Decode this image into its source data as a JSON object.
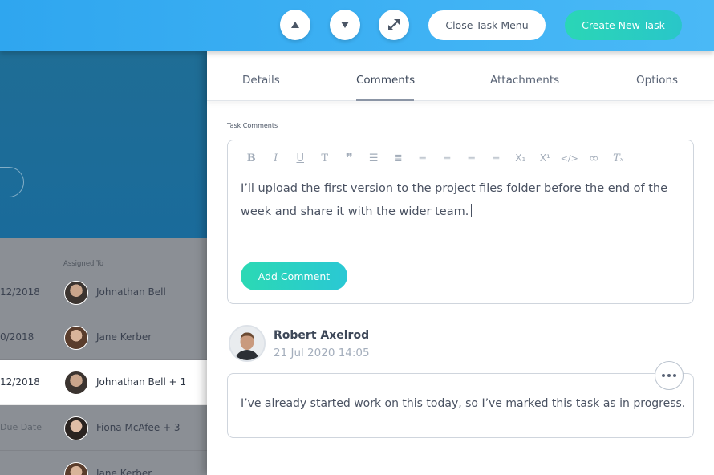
{
  "topbar": {
    "buttons": {
      "move_up": {
        "icon": "caret-up-icon"
      },
      "move_down": {
        "icon": "caret-down-icon"
      },
      "expand": {
        "icon": "expand-arrows-icon"
      },
      "close_label": "Close Task Menu",
      "create_label": "Create New Task"
    },
    "colors": {
      "bar": "#3aaef2",
      "create": "#2ad3b9"
    }
  },
  "task_list": {
    "assigned_header": "Assigned To",
    "rows": [
      {
        "date": "12/2018",
        "assignee": "Johnathan Bell",
        "selected": false
      },
      {
        "date": "0/2018",
        "assignee": "Jane Kerber",
        "selected": false
      },
      {
        "date": "12/2018",
        "assignee": "Johnathan Bell + 1",
        "selected": true
      },
      {
        "date": "Due Date",
        "assignee": "Fiona McAfee + 3",
        "selected": false
      },
      {
        "date": "",
        "assignee": "Jane Kerber",
        "selected": false
      }
    ]
  },
  "panel": {
    "tabs": [
      {
        "label": "Details",
        "active": false
      },
      {
        "label": "Comments",
        "active": true
      },
      {
        "label": "Attachments",
        "active": false
      },
      {
        "label": "Options",
        "active": false
      }
    ],
    "section_label": "Task Comments",
    "editor": {
      "toolbar": [
        {
          "name": "bold-icon",
          "glyph": "B"
        },
        {
          "name": "italic-icon",
          "glyph": "I"
        },
        {
          "name": "underline-icon",
          "glyph": "U"
        },
        {
          "name": "strikethrough-icon",
          "glyph": "T"
        },
        {
          "name": "blockquote-icon",
          "glyph": "❞"
        },
        {
          "name": "bullet-list-icon",
          "glyph": "☰"
        },
        {
          "name": "numbered-list-icon",
          "glyph": "≣"
        },
        {
          "name": "justify-icon",
          "glyph": "≡"
        },
        {
          "name": "align-left-icon",
          "glyph": "≡"
        },
        {
          "name": "align-center-icon",
          "glyph": "≡"
        },
        {
          "name": "align-right-icon",
          "glyph": "≡"
        },
        {
          "name": "subscript-icon",
          "glyph": "X₁"
        },
        {
          "name": "superscript-icon",
          "glyph": "X¹"
        },
        {
          "name": "code-icon",
          "glyph": "</>"
        },
        {
          "name": "link-icon",
          "glyph": "∞"
        },
        {
          "name": "clear-format-icon",
          "glyph": "Tₓ"
        }
      ],
      "text": "I’ll upload the first version to the project files folder before the end of the week and share it with the wider team.",
      "add_label": "Add Comment"
    },
    "comment": {
      "author": "Robert Axelrod",
      "timestamp": "21 Jul 2020 14:05",
      "body": "I’ve already started work on this today, so I’ve marked this task as in progress.",
      "more_icon": "more-dots-icon"
    }
  }
}
